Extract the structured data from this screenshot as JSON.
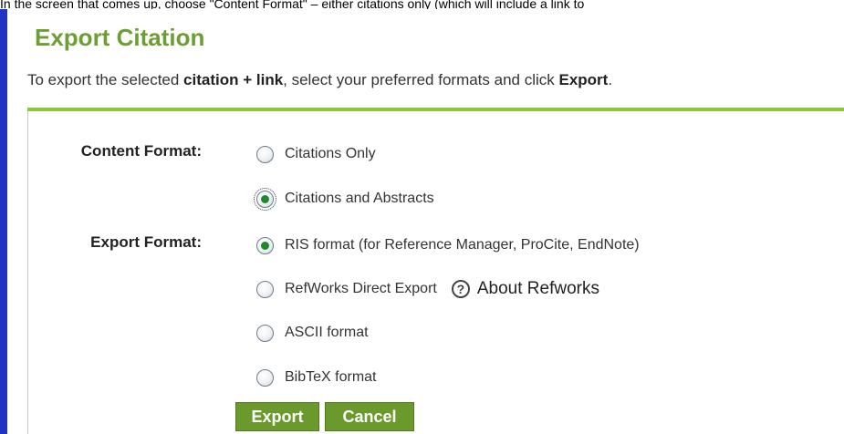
{
  "top_instruction": "In the screen that comes up, choose \"Content Format\" – either citations only (which will include a link to",
  "dialog": {
    "title": "Export Citation",
    "instruction_parts": {
      "p1": "To export the selected ",
      "b1": "citation + link",
      "p2": ", select your preferred formats and click ",
      "b2": "Export",
      "p3": "."
    }
  },
  "content_format": {
    "label": "Content Format:",
    "options": [
      {
        "label": "Citations Only",
        "checked": false
      },
      {
        "label": "Citations and Abstracts",
        "checked": true
      }
    ]
  },
  "export_format": {
    "label": "Export Format:",
    "options": [
      {
        "label": "RIS format (for Reference Manager, ProCite, EndNote)",
        "checked": true
      },
      {
        "label": "RefWorks Direct Export",
        "checked": false
      },
      {
        "label": "ASCII format",
        "checked": false
      },
      {
        "label": "BibTeX format",
        "checked": false
      }
    ],
    "about_link": "About Refworks",
    "help_icon": "?"
  },
  "buttons": {
    "export": "Export",
    "cancel": "Cancel"
  },
  "colors": {
    "title_green": "#6d9e33",
    "rule_green": "#8cc63f",
    "button_green": "#6b9a2c",
    "side_bar_blue": "#1f33c4"
  }
}
